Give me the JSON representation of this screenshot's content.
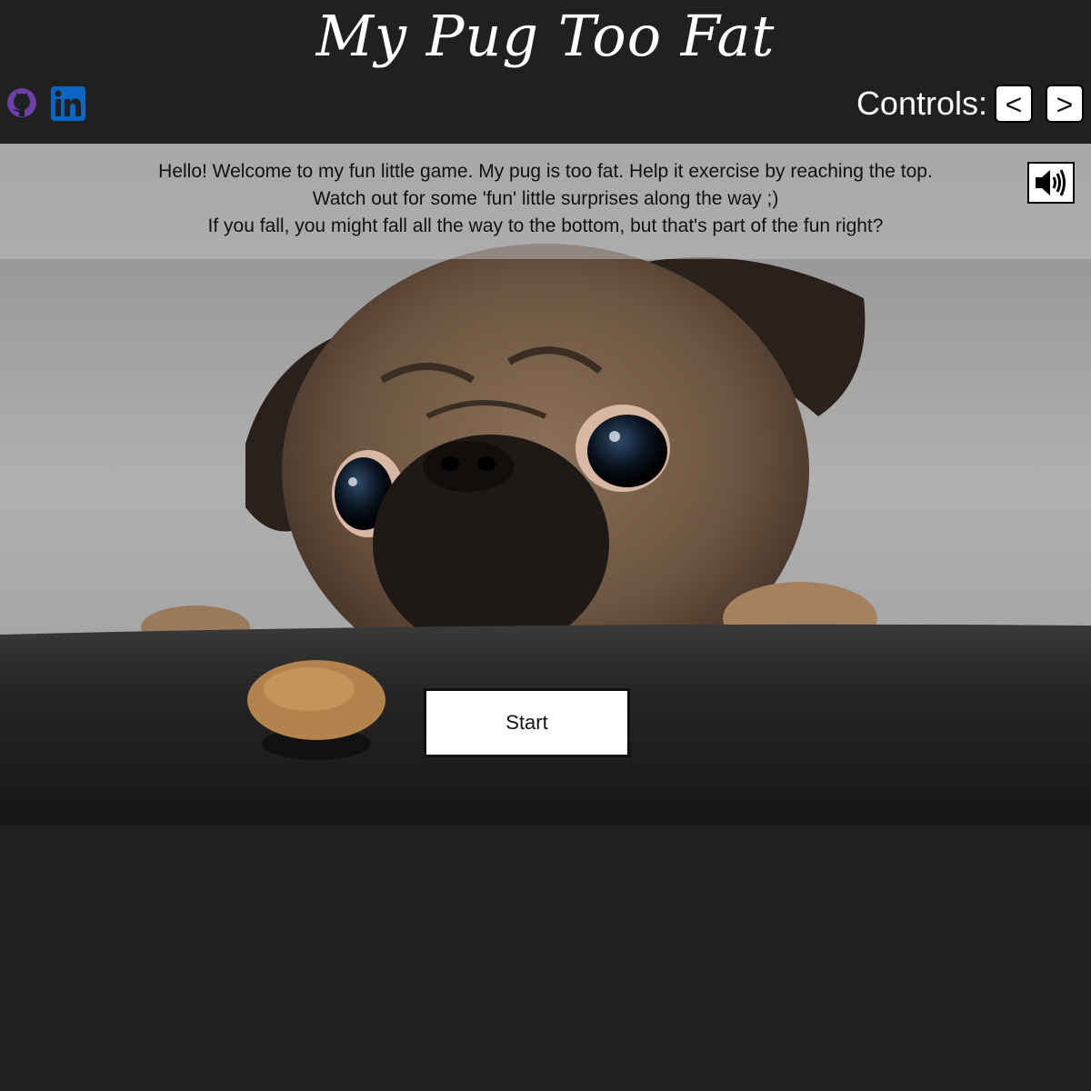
{
  "page": {
    "title": "My Pug Too Fat"
  },
  "social": {
    "links": [
      {
        "icon": "github-icon",
        "color": "#6e3fa8"
      },
      {
        "icon": "linkedin-icon",
        "color": "#0a66c2"
      }
    ]
  },
  "controls": {
    "label": "Controls:",
    "left_key": "<",
    "right_key": ">"
  },
  "intro": {
    "line1": "Hello! Welcome to my fun little game. My pug is too fat. Help it exercise by reaching the top.",
    "line2": "Watch out for some 'fun' little surprises along the way ;)",
    "line3": "If you fall, you might fall all the way to the bottom, but that's part of the fun right?"
  },
  "sound": {
    "icon": "speaker-icon"
  },
  "game": {
    "start_label": "Start"
  },
  "colors": {
    "background": "#1e2021",
    "text": "#ffffff"
  }
}
